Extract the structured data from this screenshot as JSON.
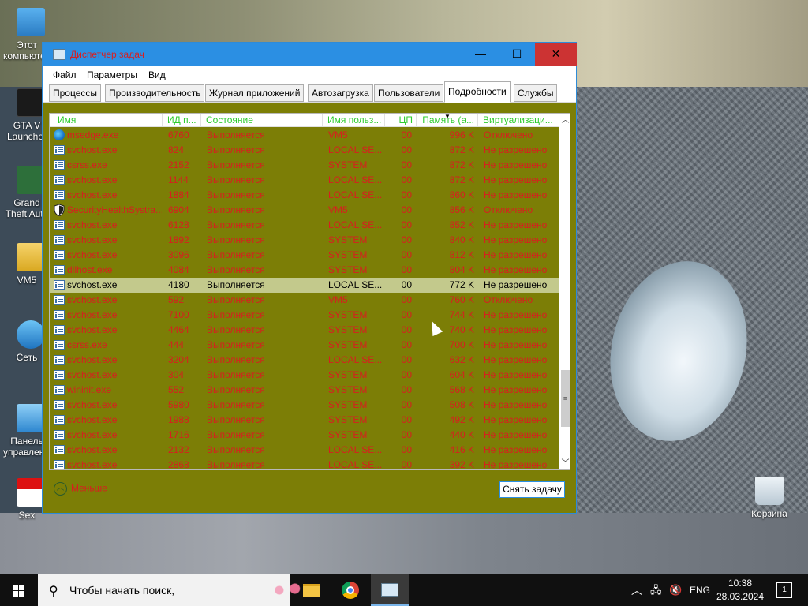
{
  "desktop": {
    "icons": [
      {
        "label": "Этот компьютер",
        "name": "this-pc"
      },
      {
        "label": "GTA V Launcher",
        "name": "gta-v-launcher"
      },
      {
        "label": "Grand Theft Auto V [...]",
        "name": "gta-v"
      },
      {
        "label": "VM5",
        "name": "vm5"
      },
      {
        "label": "Сеть",
        "name": "network"
      },
      {
        "label": "Панель управления",
        "name": "control-panel"
      },
      {
        "label": "Sex",
        "name": "pdf-sex"
      },
      {
        "label": "Корзина",
        "name": "recycle-bin"
      }
    ]
  },
  "window": {
    "title": "Диспетчер задач",
    "buttons": {
      "minimize": "—",
      "maximize": "☐",
      "close": "✕"
    },
    "menu": [
      "Файл",
      "Параметры",
      "Вид"
    ],
    "tabs": [
      "Процессы",
      "Производительность",
      "Журнал приложений",
      "Автозагрузка",
      "Пользователи",
      "Подробности",
      "Службы"
    ],
    "active_tab": "Подробности",
    "columns": [
      "Имя",
      "ИД п...",
      "Состояние",
      "Имя польз...",
      "ЦП",
      "Память (а...",
      "Виртуализаци..."
    ],
    "rows": [
      {
        "name": "msedge.exe",
        "pid": "6760",
        "status": "Выполняется",
        "user": "VM5",
        "cpu": "00",
        "mem": "996 K",
        "virt": "Отключено",
        "icon": "edge-icon"
      },
      {
        "name": "svchost.exe",
        "pid": "824",
        "status": "Выполняется",
        "user": "LOCAL SE...",
        "cpu": "00",
        "mem": "872 K",
        "virt": "Не разрешено",
        "icon": "process-icon"
      },
      {
        "name": "csrss.exe",
        "pid": "2152",
        "status": "Выполняется",
        "user": "SYSTEM",
        "cpu": "00",
        "mem": "872 K",
        "virt": "Не разрешено",
        "icon": "process-icon"
      },
      {
        "name": "svchost.exe",
        "pid": "1144",
        "status": "Выполняется",
        "user": "LOCAL SE...",
        "cpu": "00",
        "mem": "872 K",
        "virt": "Не разрешено",
        "icon": "process-icon"
      },
      {
        "name": "svchost.exe",
        "pid": "1884",
        "status": "Выполняется",
        "user": "LOCAL SE...",
        "cpu": "00",
        "mem": "860 K",
        "virt": "Не разрешено",
        "icon": "process-icon"
      },
      {
        "name": "SecurityHealthSystra...",
        "pid": "6904",
        "status": "Выполняется",
        "user": "VM5",
        "cpu": "00",
        "mem": "856 K",
        "virt": "Отключено",
        "icon": "shield-icon"
      },
      {
        "name": "svchost.exe",
        "pid": "6128",
        "status": "Выполняется",
        "user": "LOCAL SE...",
        "cpu": "00",
        "mem": "852 K",
        "virt": "Не разрешено",
        "icon": "process-icon"
      },
      {
        "name": "svchost.exe",
        "pid": "1892",
        "status": "Выполняется",
        "user": "SYSTEM",
        "cpu": "00",
        "mem": "840 K",
        "virt": "Не разрешено",
        "icon": "process-icon"
      },
      {
        "name": "svchost.exe",
        "pid": "3096",
        "status": "Выполняется",
        "user": "SYSTEM",
        "cpu": "00",
        "mem": "812 K",
        "virt": "Не разрешено",
        "icon": "process-icon"
      },
      {
        "name": "dllhost.exe",
        "pid": "4084",
        "status": "Выполняется",
        "user": "SYSTEM",
        "cpu": "00",
        "mem": "804 K",
        "virt": "Не разрешено",
        "icon": "process-icon"
      },
      {
        "name": "svchost.exe",
        "pid": "4180",
        "status": "Выполняется",
        "user": "LOCAL SE...",
        "cpu": "00",
        "mem": "772 K",
        "virt": "Не разрешено",
        "icon": "process-icon",
        "selected": true
      },
      {
        "name": "svchost.exe",
        "pid": "592",
        "status": "Выполняется",
        "user": "VM5",
        "cpu": "00",
        "mem": "760 K",
        "virt": "Отключено",
        "icon": "process-icon"
      },
      {
        "name": "svchost.exe",
        "pid": "7100",
        "status": "Выполняется",
        "user": "SYSTEM",
        "cpu": "00",
        "mem": "744 K",
        "virt": "Не разрешено",
        "icon": "process-icon"
      },
      {
        "name": "svchost.exe",
        "pid": "4464",
        "status": "Выполняется",
        "user": "SYSTEM",
        "cpu": "00",
        "mem": "740 K",
        "virt": "Не разрешено",
        "icon": "process-icon"
      },
      {
        "name": "csrss.exe",
        "pid": "444",
        "status": "Выполняется",
        "user": "SYSTEM",
        "cpu": "00",
        "mem": "700 K",
        "virt": "Не разрешено",
        "icon": "process-icon"
      },
      {
        "name": "svchost.exe",
        "pid": "3204",
        "status": "Выполняется",
        "user": "LOCAL SE...",
        "cpu": "00",
        "mem": "632 K",
        "virt": "Не разрешено",
        "icon": "process-icon"
      },
      {
        "name": "svchost.exe",
        "pid": "304",
        "status": "Выполняется",
        "user": "SYSTEM",
        "cpu": "00",
        "mem": "604 K",
        "virt": "Не разрешено",
        "icon": "process-icon"
      },
      {
        "name": "wininit.exe",
        "pid": "552",
        "status": "Выполняется",
        "user": "SYSTEM",
        "cpu": "00",
        "mem": "568 K",
        "virt": "Не разрешено",
        "icon": "process-icon"
      },
      {
        "name": "svchost.exe",
        "pid": "5980",
        "status": "Выполняется",
        "user": "SYSTEM",
        "cpu": "00",
        "mem": "508 K",
        "virt": "Не разрешено",
        "icon": "process-icon"
      },
      {
        "name": "svchost.exe",
        "pid": "1988",
        "status": "Выполняется",
        "user": "SYSTEM",
        "cpu": "00",
        "mem": "492 K",
        "virt": "Не разрешено",
        "icon": "process-icon"
      },
      {
        "name": "svchost.exe",
        "pid": "1716",
        "status": "Выполняется",
        "user": "SYSTEM",
        "cpu": "00",
        "mem": "440 K",
        "virt": "Не разрешено",
        "icon": "process-icon"
      },
      {
        "name": "svchost.exe",
        "pid": "2132",
        "status": "Выполняется",
        "user": "LOCAL SE...",
        "cpu": "00",
        "mem": "416 K",
        "virt": "Не разрешено",
        "icon": "process-icon"
      },
      {
        "name": "svchost.exe",
        "pid": "2868",
        "status": "Выполняется",
        "user": "LOCAL SE...",
        "cpu": "00",
        "mem": "392 K",
        "virt": "Не разрешено",
        "icon": "process-icon"
      }
    ],
    "footer": {
      "less_label": "Меньше",
      "end_task_label": "Снять задачу"
    }
  },
  "taskbar": {
    "search_placeholder": "Чтобы начать поиск,",
    "apps": [
      "file-explorer-icon",
      "chrome-icon",
      "task-manager-icon"
    ],
    "language": "ENG",
    "time": "10:38",
    "date": "28.03.2024",
    "notifications": "1"
  },
  "colors": {
    "window_bg": "#7c7e06",
    "row_text": "#d61f1f",
    "header_text": "#2ecc2e",
    "titlebar": "#2b8fe3",
    "title_text": "#d82020"
  }
}
